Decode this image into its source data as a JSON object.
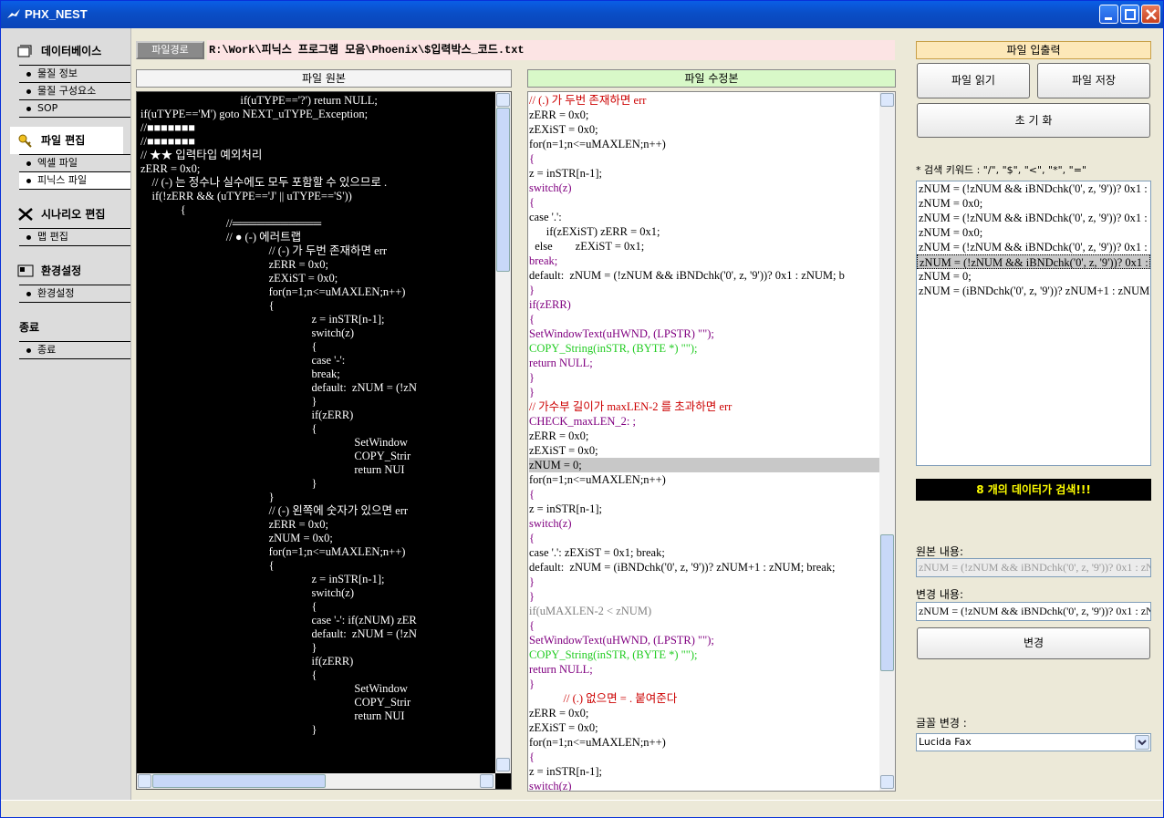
{
  "window": {
    "title": "PHX_NEST"
  },
  "sidebar": {
    "groups": [
      {
        "label": "데이터베이스",
        "icon": "database-icon",
        "items": [
          "물질 정보",
          "물질 구성요소",
          "SOP"
        ]
      },
      {
        "label": "파일 편집",
        "icon": "key-icon",
        "items": [
          "엑셀 파일",
          "피닉스 파일"
        ]
      },
      {
        "label": "시나리오 편집",
        "icon": "scenario-icon",
        "items": [
          "맵 편집"
        ]
      },
      {
        "label": "환경설정",
        "icon": "settings-icon",
        "items": [
          "환경설정"
        ]
      },
      {
        "label": "종료",
        "icon": "",
        "items": [
          "종료"
        ]
      }
    ]
  },
  "path": {
    "label": "파일경로",
    "value": "R:\\Work\\피닉스 프로그램 모음\\Phoenix\\$입력박스_코드.txt"
  },
  "panes": {
    "original_title": "파일 원본",
    "modified_title": "파일 수정본"
  },
  "original_code": [
    "                                   if(uTYPE=='?') return NULL;",
    "if(uTYPE=='M') goto NEXT_uTYPE_Exception;",
    "//■■■■■■■",
    "//■■■■■■■",
    "// ★★ 입력타입 예외처리",
    "zERR = 0x0;",
    "    // (-) 는 정수나 실수에도 모두 포함할 수 있으므로 .",
    "    if(!zERR && (uTYPE=='J' || uTYPE=='S'))",
    "              {",
    "                              //═══════════",
    "                              // ● (-) 에러트랩",
    "                                             // (-) 가 두번 존재하면 err",
    "                                             zERR = 0x0;",
    "                                             zEXiST = 0x0;",
    "                                             for(n=1;n<=uMAXLEN;n++)",
    "                                             {",
    "                                                            z = inSTR[n-1];",
    "                                                            switch(z)",
    "                                                            {",
    "                                                            case '-':",
    "",
    "",
    "                                                            break;",
    "                                                            default:  zNUM = (!zN",
    "                                                            }",
    "                                                            if(zERR)",
    "                                                            {",
    "                                                                           SetWindow",
    "                                                                           COPY_Strir",
    "                                                                           return NUI",
    "                                                            }",
    "                                             }",
    "                                             // (-) 왼쪽에 숫자가 있으면 err",
    "                                             zERR = 0x0;",
    "                                             zNUM = 0x0;",
    "                                             for(n=1;n<=uMAXLEN;n++)",
    "                                             {",
    "                                                            z = inSTR[n-1];",
    "                                                            switch(z)",
    "                                                            {",
    "                                                            case '-': if(zNUM) zER",
    "                                                            default:  zNUM = (!zN",
    "                                                            }",
    "                                                            if(zERR)",
    "                                                            {",
    "                                                                           SetWindow",
    "                                                                           COPY_Strir",
    "                                                                           return NUI",
    "                                                            }"
  ],
  "modified_code": [
    {
      "t": "// (.) 가 두번 존재하면 err",
      "c": "red"
    },
    {
      "t": "zERR = 0x0;",
      "c": "black"
    },
    {
      "t": "zEXiST = 0x0;",
      "c": "black"
    },
    {
      "t": "for(n=1;n<=uMAXLEN;n++)",
      "c": "black"
    },
    {
      "t": "{",
      "c": "purple"
    },
    {
      "t": "z = inSTR[n-1];",
      "c": "black"
    },
    {
      "t": "switch(z)",
      "c": "purple"
    },
    {
      "t": "{",
      "c": "purple"
    },
    {
      "t": "case '.':",
      "c": "black"
    },
    {
      "t": "      if(zEXiST) zERR = 0x1;",
      "c": "black"
    },
    {
      "t": "  else        zEXiST = 0x1;",
      "c": "black"
    },
    {
      "t": "break;",
      "c": "purple"
    },
    {
      "t": "default:  zNUM = (!zNUM && iBNDchk('0', z, '9'))? 0x1 : zNUM; b",
      "c": "black"
    },
    {
      "t": "}",
      "c": "purple"
    },
    {
      "t": "if(zERR)",
      "c": "purple"
    },
    {
      "t": "{",
      "c": "purple"
    },
    {
      "t": "SetWindowText(uHWND, (LPSTR) \"\");",
      "c": "purple"
    },
    {
      "t": "COPY_String(inSTR, (BYTE *) \"\");",
      "c": "green"
    },
    {
      "t": "return NULL;",
      "c": "purple"
    },
    {
      "t": "}",
      "c": "purple"
    },
    {
      "t": "}",
      "c": "purple"
    },
    {
      "t": "// 가수부 길이가 maxLEN-2 를 초과하면 err",
      "c": "red"
    },
    {
      "t": "CHECK_maxLEN_2: ;",
      "c": "purple"
    },
    {
      "t": "zERR = 0x0;",
      "c": "black"
    },
    {
      "t": "zEXiST = 0x0;",
      "c": "black"
    },
    {
      "t": "zNUM = 0;",
      "c": "hl"
    },
    {
      "t": "for(n=1;n<=uMAXLEN;n++)",
      "c": "black"
    },
    {
      "t": "{",
      "c": "purple"
    },
    {
      "t": "z = inSTR[n-1];",
      "c": "black"
    },
    {
      "t": "switch(z)",
      "c": "purple"
    },
    {
      "t": "{",
      "c": "purple"
    },
    {
      "t": "case '.': zEXiST = 0x1; break;",
      "c": "black"
    },
    {
      "t": "default:  zNUM = (iBNDchk('0', z, '9'))? zNUM+1 : zNUM; break;",
      "c": "black"
    },
    {
      "t": "}",
      "c": "purple"
    },
    {
      "t": "}",
      "c": "purple"
    },
    {
      "t": "if(uMAXLEN-2 < zNUM)",
      "c": "gray"
    },
    {
      "t": "{",
      "c": "purple"
    },
    {
      "t": "SetWindowText(uHWND, (LPSTR) \"\");",
      "c": "purple"
    },
    {
      "t": "COPY_String(inSTR, (BYTE *) \"\");",
      "c": "green"
    },
    {
      "t": "return NULL;",
      "c": "purple"
    },
    {
      "t": "}",
      "c": "purple"
    },
    {
      "t": "            // (.) 없으면 = . 붙여준다",
      "c": "red"
    },
    {
      "t": "zERR = 0x0;",
      "c": "black"
    },
    {
      "t": "zEXiST = 0x0;",
      "c": "black"
    },
    {
      "t": "for(n=1;n<=uMAXLEN;n++)",
      "c": "black"
    },
    {
      "t": "{",
      "c": "purple"
    },
    {
      "t": "z = inSTR[n-1];",
      "c": "black"
    },
    {
      "t": "switch(z)",
      "c": "purple"
    }
  ],
  "file_io": {
    "title": "파일 입출력",
    "read_label": "파일 읽기",
    "save_label": "파일 저장",
    "reset_label": "초 기 화"
  },
  "search": {
    "keywords_label": "* 검색 키워드 : \"/\", \"$\", \"<\", \"*\", \"=\"",
    "results": [
      "zNUM = (!zNUM && iBNDchk('0', z, '9'))? 0x1 : zNUM;",
      "zNUM = 0x0;",
      "zNUM = (!zNUM && iBNDchk('0', z, '9'))? 0x1 : zNUM;",
      "zNUM = 0x0;",
      "zNUM = (!zNUM && iBNDchk('0', z, '9'))? 0x1 : zNUM;",
      "zNUM = (!zNUM && iBNDchk('0', z, '9'))? 0x1 : zNUM;",
      "zNUM = 0;",
      "zNUM = (iBNDchk('0', z, '9'))? zNUM+1 : zNUM;"
    ],
    "selected_index": 5,
    "count_text": "8 개의 데이터가 검색!!!"
  },
  "edit": {
    "original_label": "원본 내용:",
    "original_value": "zNUM = (!zNUM && iBNDchk('0', z, '9'))? 0x1 : zNUM;",
    "changed_label": "변경 내용:",
    "changed_value": "zNUM = (!zNUM && iBNDchk('0', z, '9'))? 0x1 : zNUM;",
    "apply_label": "변경"
  },
  "font": {
    "label": "글꼴 변경 :",
    "selected": "Lucida Fax"
  }
}
